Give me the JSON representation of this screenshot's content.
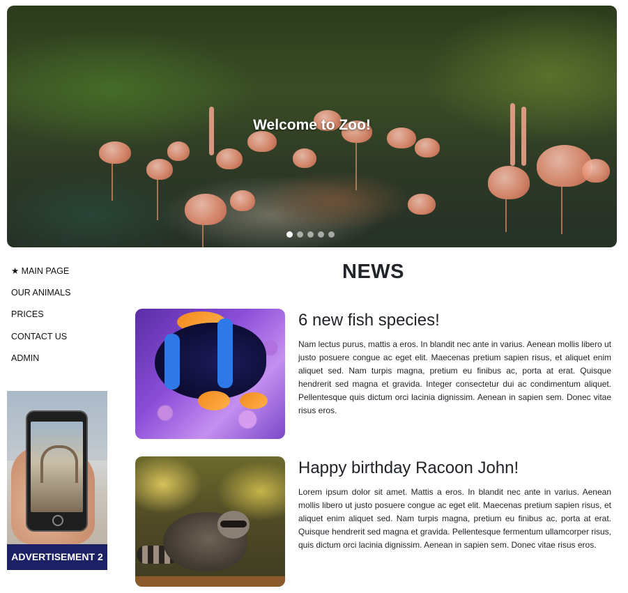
{
  "hero": {
    "title": "Welcome to Zoo!",
    "slides_count": 5,
    "active_slide": 1
  },
  "nav": {
    "items": [
      {
        "label": "★ MAIN PAGE"
      },
      {
        "label": "OUR ANIMALS"
      },
      {
        "label": "PRICES"
      },
      {
        "label": "CONTACT US"
      },
      {
        "label": "ADMIN"
      }
    ]
  },
  "advertisement": {
    "label": "ADVERTISEMENT 2",
    "label_color": "#1c2166"
  },
  "news": {
    "title": "NEWS",
    "articles": [
      {
        "heading": "6 new fish species!",
        "text": "Nam lectus purus, mattis a eros. In blandit nec ante in varius. Aenean mollis libero ut justo posuere congue ac eget elit. Maecenas pretium sapien risus, et aliquet enim aliquet sed. Nam turpis magna, pretium eu finibus ac, porta at erat. Quisque hendrerit sed magna et gravida. Integer consectetur dui ac condimentum aliquet. Pellentesque quis dictum orci lacinia dignissim. Aenean in sapien sem. Donec vitae risus eros."
      },
      {
        "heading": "Happy birthday Racoon John!",
        "text": "Lorem ipsum dolor sit amet. Mattis a eros. In blandit nec ante in varius. Aenean mollis libero ut justo posuere congue ac eget elit. Maecenas pretium sapien risus, et aliquet enim aliquet sed. Nam turpis magna, pretium eu finibus ac, porta at erat. Quisque hendrerit sed magna et gravida. Pellentesque fermentum ullamcorper risus, quis dictum orci lacinia dignissim. Aenean in sapien sem. Donec vitae risus eros."
      }
    ]
  }
}
